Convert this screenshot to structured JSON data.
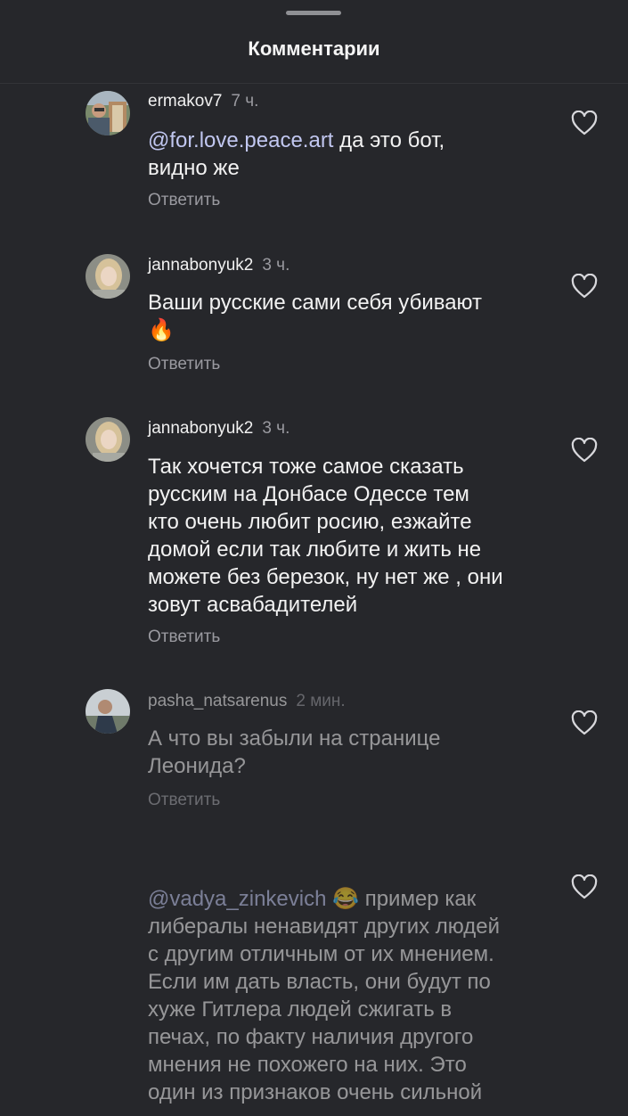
{
  "header": {
    "title": "Комментарии"
  },
  "comments": [
    {
      "username": "ermakov7",
      "time": "7 ч.",
      "mention": "@for.love.peace.art",
      "line1_rest": " да это бот,",
      "line2": "видно же",
      "reply": "Ответить"
    },
    {
      "username": "jannabonyuk2",
      "time": "3 ч.",
      "line1": "Ваши русские сами себя убивают",
      "emoji": "🔥",
      "reply": "Ответить"
    },
    {
      "username": "jannabonyuk2",
      "time": "3 ч.",
      "lines": [
        "Так хочется тоже самое сказать",
        "русским на Донбасе Одессе тем",
        "кто очень любит росию, езжайте",
        "домой если так любите и жить не",
        "можете без березок, ну нет же , они",
        "зовут асвабадителей"
      ],
      "reply": "Ответить"
    },
    {
      "username": "pasha_natsarenus",
      "time": "2 мин.",
      "line1": "А что вы забыли на странице",
      "line2": "Леонида?",
      "reply": "Ответить"
    },
    {
      "mention": "@vadya_zinkevich",
      "emoji": "😂",
      "line1_rest": " пример как",
      "lines": [
        "либералы ненавидят других людей",
        "с другим отличным от их мнением.",
        "Если им дать власть, они будут по",
        "хуже Гитлера людей сжигать в",
        "печах, по факту наличия другого",
        "мнения не похожего на них. Это",
        "один из признаков очень сильной"
      ]
    }
  ],
  "icons": {
    "like": "heart-outline-icon"
  },
  "colors": {
    "background": "#26272b",
    "mention": "#c1c7f0",
    "secondary_text": "#9a9aa0"
  }
}
